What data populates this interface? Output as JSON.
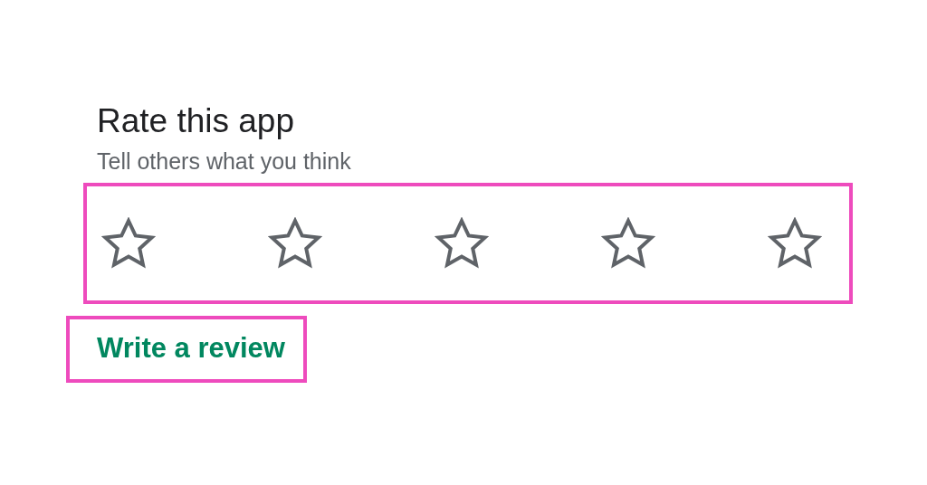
{
  "section": {
    "title": "Rate this app",
    "subtitle": "Tell others what you think"
  },
  "rating": {
    "stars": 0,
    "highlighted": true
  },
  "review_link": {
    "label": "Write a review",
    "highlighted": true
  }
}
